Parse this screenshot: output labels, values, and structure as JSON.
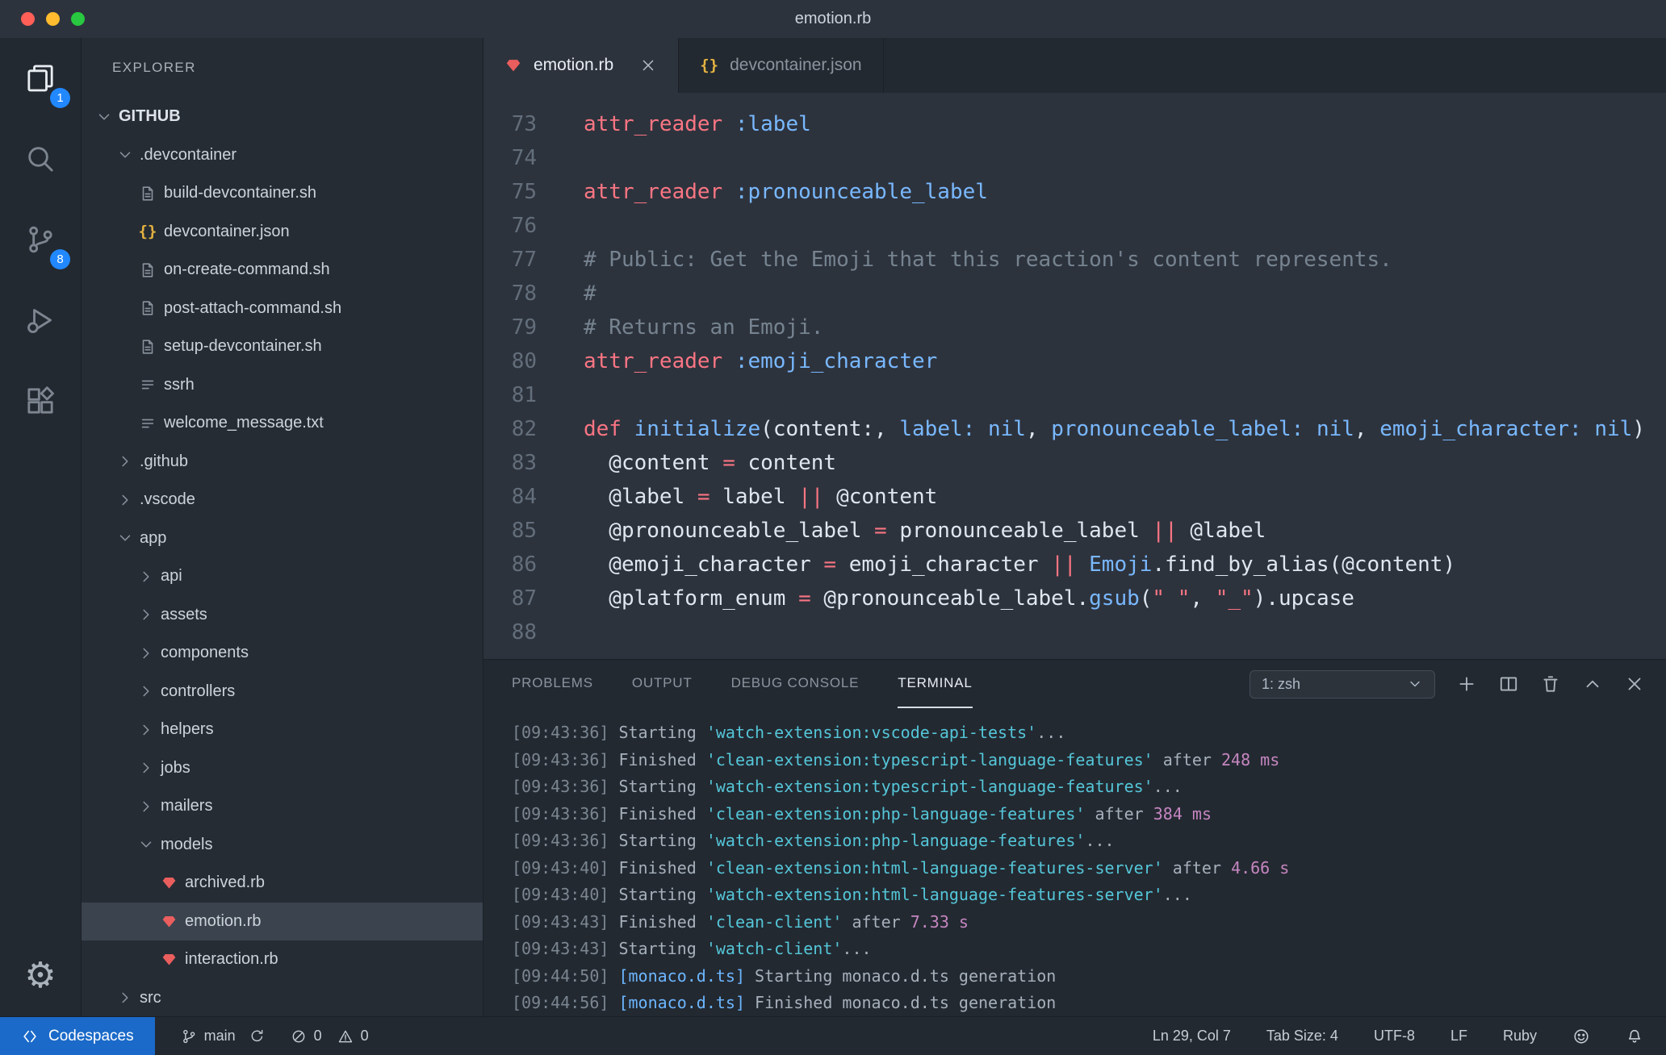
{
  "window": {
    "title": "emotion.rb"
  },
  "colors": {
    "badge": "#2188ff",
    "codespaces_bg": "#1b6ac9",
    "ruby": "#ea5e5e",
    "json": "#e3b341",
    "code": {
      "fg": "#dfe6ee",
      "red": "#f97583",
      "blue": "#79b8ff",
      "gray": "#768390"
    },
    "terminal": {
      "gray": "#7b8691",
      "txt": "#a6b0bb",
      "teal": "#54c6d8",
      "purple": "#c586c0",
      "blue": "#6cb6ff"
    }
  },
  "activity_bar": {
    "items": [
      {
        "name": "explorer",
        "badge": "1",
        "active": true
      },
      {
        "name": "search"
      },
      {
        "name": "source-control",
        "badge": "8"
      },
      {
        "name": "run-debug"
      },
      {
        "name": "extensions"
      }
    ],
    "bottom": [
      {
        "name": "settings"
      }
    ]
  },
  "sidebar": {
    "title": "EXPLORER",
    "tree": [
      {
        "label": "GITHUB",
        "indent": 0,
        "chevron": "down",
        "bold": true
      },
      {
        "label": ".devcontainer",
        "indent": 1,
        "chevron": "down"
      },
      {
        "label": "build-devcontainer.sh",
        "indent": 2,
        "icon": "shell"
      },
      {
        "label": "devcontainer.json",
        "indent": 2,
        "icon": "json"
      },
      {
        "label": "on-create-command.sh",
        "indent": 2,
        "icon": "shell"
      },
      {
        "label": "post-attach-command.sh",
        "indent": 2,
        "icon": "shell"
      },
      {
        "label": "setup-devcontainer.sh",
        "indent": 2,
        "icon": "shell"
      },
      {
        "label": "ssrh",
        "indent": 2,
        "icon": "lines"
      },
      {
        "label": "welcome_message.txt",
        "indent": 2,
        "icon": "lines"
      },
      {
        "label": ".github",
        "indent": 1,
        "chevron": "right"
      },
      {
        "label": ".vscode",
        "indent": 1,
        "chevron": "right"
      },
      {
        "label": "app",
        "indent": 1,
        "chevron": "down"
      },
      {
        "label": "api",
        "indent": 2,
        "chevron": "right"
      },
      {
        "label": "assets",
        "indent": 2,
        "chevron": "right"
      },
      {
        "label": "components",
        "indent": 2,
        "chevron": "right"
      },
      {
        "label": "controllers",
        "indent": 2,
        "chevron": "right"
      },
      {
        "label": "helpers",
        "indent": 2,
        "chevron": "right"
      },
      {
        "label": "jobs",
        "indent": 2,
        "chevron": "right"
      },
      {
        "label": "mailers",
        "indent": 2,
        "chevron": "right"
      },
      {
        "label": "models",
        "indent": 2,
        "chevron": "down"
      },
      {
        "label": "archived.rb",
        "indent": 3,
        "icon": "ruby"
      },
      {
        "label": "emotion.rb",
        "indent": 3,
        "icon": "ruby",
        "selected": true
      },
      {
        "label": "interaction.rb",
        "indent": 3,
        "icon": "ruby"
      },
      {
        "label": "src",
        "indent": 1,
        "chevron": "right"
      }
    ]
  },
  "editor": {
    "tabs": [
      {
        "label": "emotion.rb",
        "icon": "ruby",
        "active": true,
        "closable": true
      },
      {
        "label": "devcontainer.json",
        "icon": "json",
        "active": false
      }
    ],
    "code": {
      "lines": [
        {
          "num": 73,
          "segs": [
            [
              "attr_reader",
              "red"
            ],
            [
              " ",
              "fg"
            ],
            [
              ":label",
              "blue"
            ]
          ]
        },
        {
          "num": 74,
          "segs": []
        },
        {
          "num": 75,
          "segs": [
            [
              "attr_reader",
              "red"
            ],
            [
              " ",
              "fg"
            ],
            [
              ":pronounceable_label",
              "blue"
            ]
          ]
        },
        {
          "num": 76,
          "segs": []
        },
        {
          "num": 77,
          "segs": [
            [
              "# Public: Get the Emoji that this reaction's content represents.",
              "gray"
            ]
          ]
        },
        {
          "num": 78,
          "segs": [
            [
              "#",
              "gray"
            ]
          ]
        },
        {
          "num": 79,
          "segs": [
            [
              "# Returns an Emoji.",
              "gray"
            ]
          ]
        },
        {
          "num": 80,
          "segs": [
            [
              "attr_reader",
              "red"
            ],
            [
              " ",
              "fg"
            ],
            [
              ":emoji_character",
              "blue"
            ]
          ]
        },
        {
          "num": 81,
          "segs": []
        },
        {
          "num": 82,
          "segs": [
            [
              "def",
              "red"
            ],
            [
              " ",
              "fg"
            ],
            [
              "initialize",
              "blue"
            ],
            [
              "(content:, ",
              "fg"
            ],
            [
              "label:",
              "blue"
            ],
            [
              " ",
              "fg"
            ],
            [
              "nil",
              "blue"
            ],
            [
              ", ",
              "fg"
            ],
            [
              "pronounceable_label:",
              "blue"
            ],
            [
              " ",
              "fg"
            ],
            [
              "nil",
              "blue"
            ],
            [
              ", ",
              "fg"
            ],
            [
              "emoji_character:",
              "blue"
            ],
            [
              " ",
              "fg"
            ],
            [
              "nil",
              "blue"
            ],
            [
              ")",
              "fg"
            ]
          ]
        },
        {
          "num": 83,
          "segs": [
            [
              "  @content ",
              "fg"
            ],
            [
              "=",
              "red"
            ],
            [
              " content",
              "fg"
            ]
          ]
        },
        {
          "num": 84,
          "segs": [
            [
              "  @label ",
              "fg"
            ],
            [
              "=",
              "red"
            ],
            [
              " label ",
              "fg"
            ],
            [
              "||",
              "red"
            ],
            [
              " @content",
              "fg"
            ]
          ]
        },
        {
          "num": 85,
          "segs": [
            [
              "  @pronounceable_label ",
              "fg"
            ],
            [
              "=",
              "red"
            ],
            [
              " pronounceable_label ",
              "fg"
            ],
            [
              "||",
              "red"
            ],
            [
              " @label",
              "fg"
            ]
          ]
        },
        {
          "num": 86,
          "segs": [
            [
              "  @emoji_character ",
              "fg"
            ],
            [
              "=",
              "red"
            ],
            [
              " emoji_character ",
              "fg"
            ],
            [
              "||",
              "red"
            ],
            [
              " ",
              "fg"
            ],
            [
              "Emoji",
              "blue"
            ],
            [
              ".find_by_alias(@content)",
              "fg"
            ]
          ]
        },
        {
          "num": 87,
          "segs": [
            [
              "  @platform_enum ",
              "fg"
            ],
            [
              "=",
              "red"
            ],
            [
              " @pronounceable_label.",
              "fg"
            ],
            [
              "gsub",
              "blue"
            ],
            [
              "(",
              "fg"
            ],
            [
              "\" \"",
              "red"
            ],
            [
              ", ",
              "fg"
            ],
            [
              "\"_\"",
              "red"
            ],
            [
              ").upcase",
              "fg"
            ]
          ]
        },
        {
          "num": 88,
          "segs": []
        }
      ]
    }
  },
  "panel": {
    "tabs": [
      {
        "label": "PROBLEMS"
      },
      {
        "label": "OUTPUT"
      },
      {
        "label": "DEBUG CONSOLE"
      },
      {
        "label": "TERMINAL",
        "active": true
      }
    ],
    "shell_selector": "1: zsh",
    "terminal_lines": [
      {
        "segs": [
          [
            "[09:43:36] ",
            "gray"
          ],
          [
            "Starting ",
            "txt"
          ],
          [
            "'watch-extension:vscode-api-tests'",
            "teal"
          ],
          [
            "...",
            "txt"
          ]
        ]
      },
      {
        "segs": [
          [
            "[09:43:36] ",
            "gray"
          ],
          [
            "Finished ",
            "txt"
          ],
          [
            "'clean-extension:typescript-language-features'",
            "teal"
          ],
          [
            " after ",
            "txt"
          ],
          [
            "248 ms",
            "purple"
          ]
        ]
      },
      {
        "segs": [
          [
            "[09:43:36] ",
            "gray"
          ],
          [
            "Starting ",
            "txt"
          ],
          [
            "'watch-extension:typescript-language-features'",
            "teal"
          ],
          [
            "...",
            "txt"
          ]
        ]
      },
      {
        "segs": [
          [
            "[09:43:36] ",
            "gray"
          ],
          [
            "Finished ",
            "txt"
          ],
          [
            "'clean-extension:php-language-features'",
            "teal"
          ],
          [
            " after ",
            "txt"
          ],
          [
            "384 ms",
            "purple"
          ]
        ]
      },
      {
        "segs": [
          [
            "[09:43:36] ",
            "gray"
          ],
          [
            "Starting ",
            "txt"
          ],
          [
            "'watch-extension:php-language-features'",
            "teal"
          ],
          [
            "...",
            "txt"
          ]
        ]
      },
      {
        "segs": [
          [
            "[09:43:40] ",
            "gray"
          ],
          [
            "Finished ",
            "txt"
          ],
          [
            "'clean-extension:html-language-features-server'",
            "teal"
          ],
          [
            " after ",
            "txt"
          ],
          [
            "4.66 s",
            "purple"
          ]
        ]
      },
      {
        "segs": [
          [
            "[09:43:40] ",
            "gray"
          ],
          [
            "Starting ",
            "txt"
          ],
          [
            "'watch-extension:html-language-features-server'",
            "teal"
          ],
          [
            "...",
            "txt"
          ]
        ]
      },
      {
        "segs": [
          [
            "[09:43:43] ",
            "gray"
          ],
          [
            "Finished ",
            "txt"
          ],
          [
            "'clean-client'",
            "teal"
          ],
          [
            " after ",
            "txt"
          ],
          [
            "7.33 s",
            "purple"
          ]
        ]
      },
      {
        "segs": [
          [
            "[09:43:43] ",
            "gray"
          ],
          [
            "Starting ",
            "txt"
          ],
          [
            "'watch-client'",
            "teal"
          ],
          [
            "...",
            "txt"
          ]
        ]
      },
      {
        "segs": [
          [
            "[09:44:50] ",
            "gray"
          ],
          [
            "[monaco.d.ts]",
            "blue"
          ],
          [
            " Starting monaco.d.ts generation",
            "txt"
          ]
        ]
      },
      {
        "segs": [
          [
            "[09:44:56] ",
            "gray"
          ],
          [
            "[monaco.d.ts]",
            "blue"
          ],
          [
            " Finished monaco.d.ts generation",
            "txt"
          ]
        ]
      }
    ]
  },
  "status_bar": {
    "codespaces": "Codespaces",
    "branch": "main",
    "errors": "0",
    "warnings": "0",
    "right": [
      "Ln 29, Col 7",
      "Tab Size: 4",
      "UTF-8",
      "LF",
      "Ruby"
    ]
  }
}
